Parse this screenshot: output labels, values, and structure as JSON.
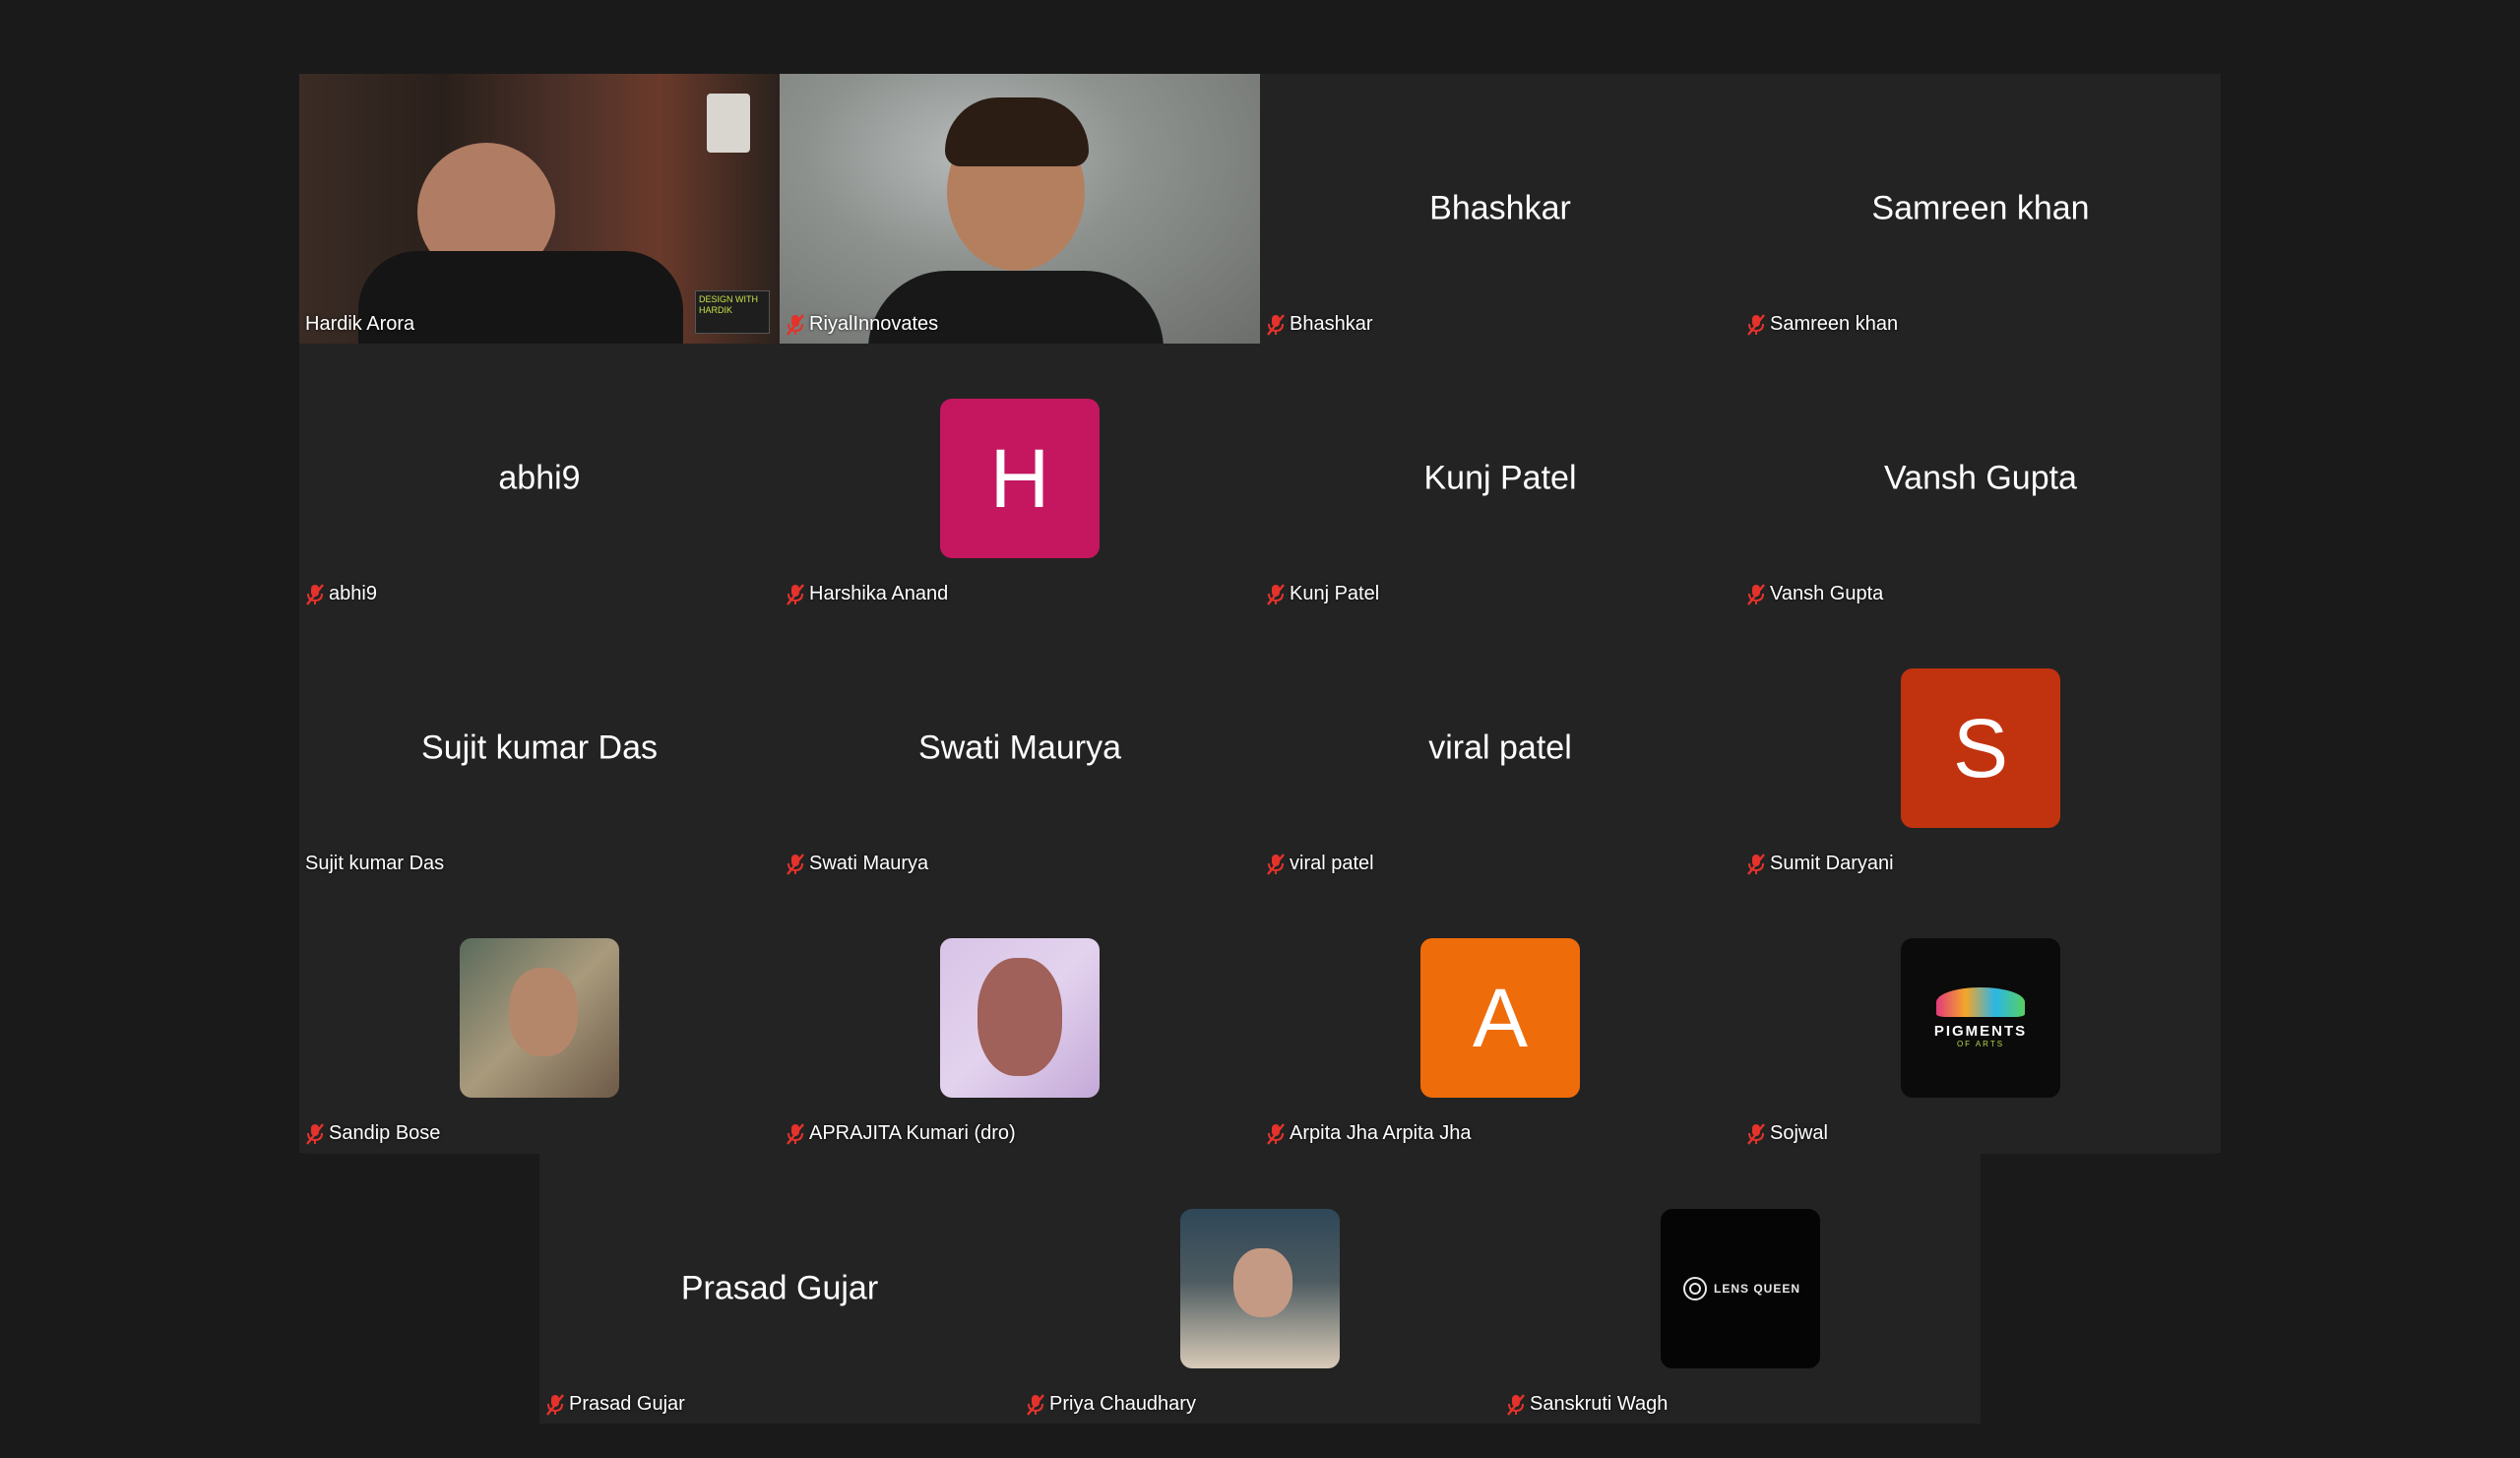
{
  "participants": {
    "hardik": {
      "name": "Hardik Arora",
      "badge": "DESIGN WITH HARDIK"
    },
    "riyal": {
      "name": "RiyalInnovates"
    },
    "bhashkar": {
      "display": "Bhashkar",
      "name": "Bhashkar"
    },
    "samreen": {
      "display": "Samreen khan",
      "name": "Samreen khan"
    },
    "abhi9": {
      "display": "abhi9",
      "name": "abhi9"
    },
    "harshika": {
      "initial": "H",
      "name": "Harshika Anand",
      "color": "#c4175f"
    },
    "kunj": {
      "display": "Kunj Patel",
      "name": "Kunj Patel"
    },
    "vansh": {
      "display": "Vansh Gupta",
      "name": "Vansh Gupta"
    },
    "sujit": {
      "display": "Sujit kumar Das",
      "name": "Sujit kumar Das"
    },
    "swati": {
      "display": "Swati Maurya",
      "name": "Swati Maurya"
    },
    "viral": {
      "display": "viral patel",
      "name": "viral patel"
    },
    "sumit": {
      "initial": "S",
      "name": "Sumit Daryani",
      "color": "#c1330f"
    },
    "sandip": {
      "name": "Sandip Bose"
    },
    "aprajita": {
      "name": "APRAJITA Kumari (dro)"
    },
    "arpita": {
      "initial": "A",
      "name": "Arpita Jha Arpita Jha",
      "color": "#ef6c0a"
    },
    "sojwal": {
      "name": "Sojwal",
      "logo_title": "PIGMENTS",
      "logo_sub": "OF ARTS"
    },
    "prasad": {
      "display": "Prasad Gujar",
      "name": "Prasad Gujar"
    },
    "priya": {
      "name": "Priya Chaudhary"
    },
    "sanskruti": {
      "name": "Sanskruti Wagh",
      "logo_text": "LENS QUEEN"
    }
  },
  "colors": {
    "background": "#1a1a1a",
    "tile": "#232323",
    "active_speaker": "#35c24a",
    "muted_icon": "#e5322b"
  }
}
